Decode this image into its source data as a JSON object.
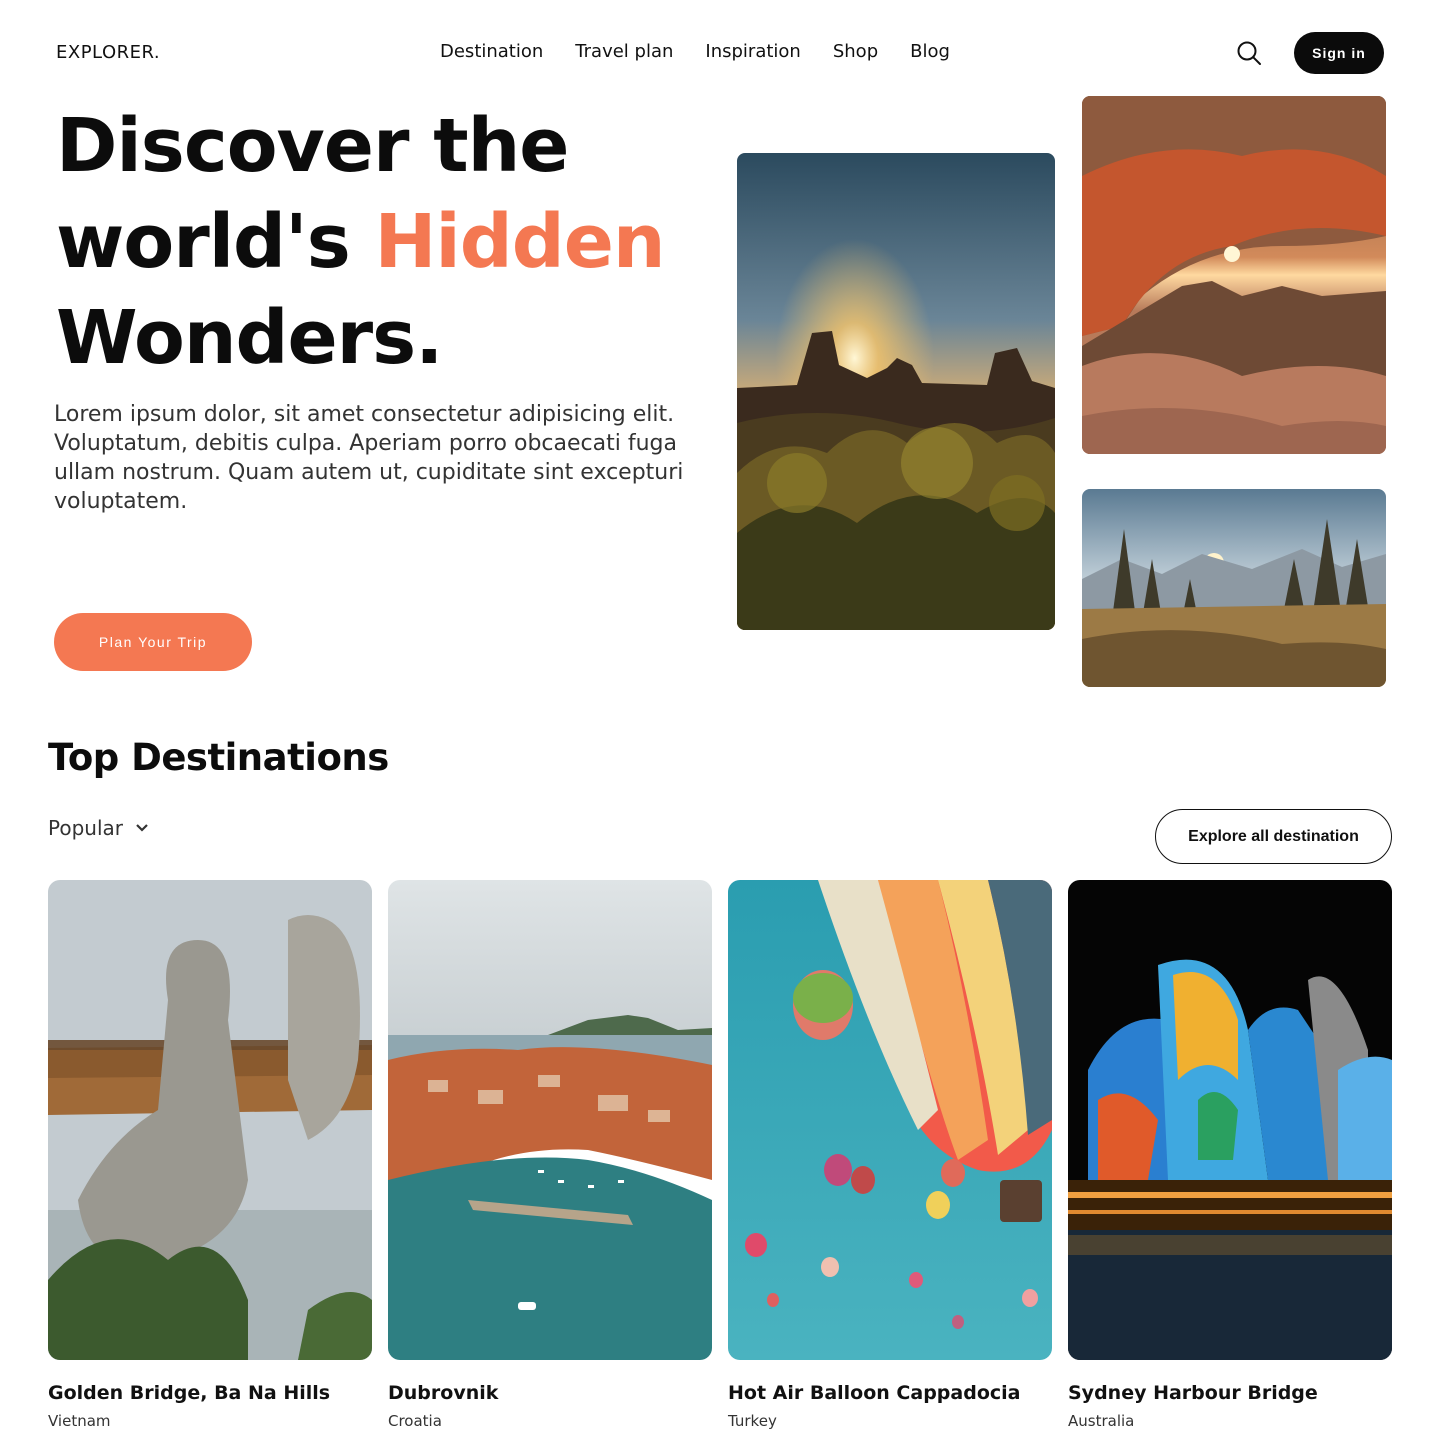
{
  "brand": {
    "logo": "EXPLORER."
  },
  "nav": {
    "items": [
      "Destination",
      "Travel plan",
      "Inspiration",
      "Shop",
      "Blog"
    ]
  },
  "header": {
    "search_icon": "search-icon",
    "signin_label": "Sign in"
  },
  "hero": {
    "title_line1": "Discover the",
    "title_line2_start": "world's ",
    "title_line2_accent": "Hidden",
    "title_line3": "Wonders.",
    "description": "Lorem ipsum dolor, sit amet consectetur adipisicing elit. Voluptatum, debitis culpa. Aperiam porro obcaecati fuga ullam nostrum. Quam autem ut, cupiditate sint excepturi voluptatem.",
    "cta_label": "Plan Your Trip"
  },
  "colors": {
    "accent": "#f47852",
    "dark": "#0b0b0b"
  },
  "destinations": {
    "title": "Top Destinations",
    "filter_label": "Popular",
    "explore_label": "Explore all destination",
    "cards": [
      {
        "name": "Golden Bridge, Ba Na Hills",
        "country": "Vietnam"
      },
      {
        "name": "Dubrovnik",
        "country": "Croatia"
      },
      {
        "name": "Hot Air Balloon Cappadocia",
        "country": "Turkey"
      },
      {
        "name": "Sydney Harbour Bridge",
        "country": "Australia"
      }
    ]
  }
}
